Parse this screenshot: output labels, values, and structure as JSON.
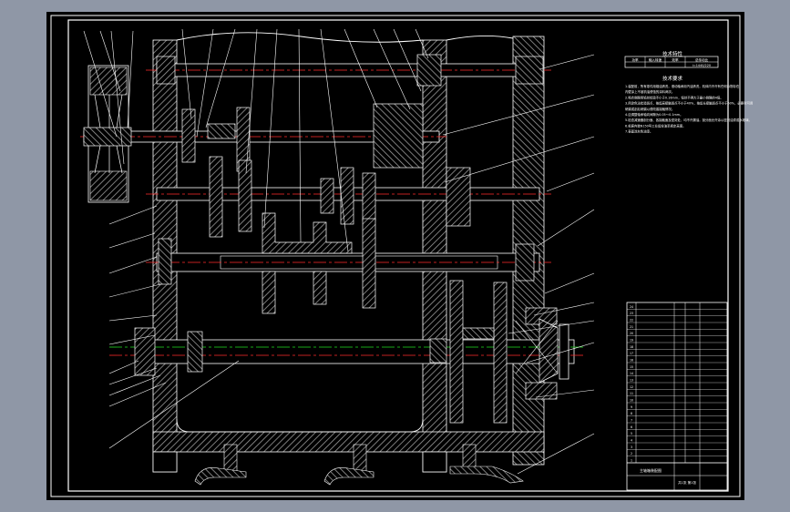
{
  "colors": {
    "background": "#8f97a6",
    "sheet": "#000000",
    "line": "#ffffff",
    "centerline": "#ff2a2a",
    "axis_alt": "#22dd22",
    "section": "#bbbbbb"
  },
  "tech_table": {
    "title": "技术特性",
    "headers": [
      "功率",
      "输入转速",
      "效率",
      "总传动比"
    ],
    "values": [
      "",
      "",
      "",
      "i=1440/220"
    ]
  },
  "tech_req": {
    "title": "技术要求",
    "lines": [
      "1.装配前，所有零件用煤油清洗，滚动轴承用汽油清洗，机体内不许有任何杂物存在，",
      "  内壁涂上不被机油侵蚀的涂料两次。",
      "2.啮合侧隙用铅丝检验不小于0.16mm，铅丝不得大于最小侧隙的4倍。",
      "3.用涂色法检验斑点，按齿高接触斑点不小于40%，按齿长接触斑点不小于50%，必要时可用",
      "  研磨或刮后研磨以便改善接触情况。",
      "4.应调整轴承轴向间隙为0.05～0.1mm。",
      "5.检查减速器剖分面、各接触面及密封处，均不许漏油。剖分面允许涂以密封油漆或水玻璃，",
      "6.机座内装N150号工业齿轮油至规定高度。",
      "7.表面涂灰色油漆。"
    ]
  },
  "bom_rows": [
    {
      "no": "24",
      "name": "",
      "qty": "",
      "mat": "",
      "note": ""
    },
    {
      "no": "23",
      "name": "",
      "qty": "",
      "mat": "",
      "note": ""
    },
    {
      "no": "22",
      "name": "",
      "qty": "",
      "mat": "",
      "note": ""
    },
    {
      "no": "21",
      "name": "",
      "qty": "",
      "mat": "",
      "note": ""
    },
    {
      "no": "20",
      "name": "",
      "qty": "",
      "mat": "",
      "note": ""
    },
    {
      "no": "19",
      "name": "",
      "qty": "",
      "mat": "",
      "note": ""
    },
    {
      "no": "18",
      "name": "",
      "qty": "",
      "mat": "",
      "note": ""
    },
    {
      "no": "17",
      "name": "",
      "qty": "",
      "mat": "",
      "note": ""
    },
    {
      "no": "16",
      "name": "",
      "qty": "",
      "mat": "",
      "note": ""
    },
    {
      "no": "15",
      "name": "",
      "qty": "",
      "mat": "",
      "note": ""
    },
    {
      "no": "14",
      "name": "",
      "qty": "",
      "mat": "",
      "note": ""
    },
    {
      "no": "13",
      "name": "",
      "qty": "",
      "mat": "",
      "note": ""
    },
    {
      "no": "12",
      "name": "",
      "qty": "",
      "mat": "",
      "note": ""
    },
    {
      "no": "11",
      "name": "",
      "qty": "",
      "mat": "",
      "note": ""
    },
    {
      "no": "10",
      "name": "",
      "qty": "",
      "mat": "",
      "note": ""
    },
    {
      "no": "9",
      "name": "",
      "qty": "",
      "mat": "",
      "note": ""
    },
    {
      "no": "8",
      "name": "",
      "qty": "",
      "mat": "",
      "note": ""
    },
    {
      "no": "7",
      "name": "",
      "qty": "",
      "mat": "",
      "note": ""
    },
    {
      "no": "6",
      "name": "",
      "qty": "",
      "mat": "",
      "note": ""
    },
    {
      "no": "5",
      "name": "",
      "qty": "",
      "mat": "",
      "note": ""
    },
    {
      "no": "4",
      "name": "",
      "qty": "",
      "mat": "",
      "note": ""
    },
    {
      "no": "3",
      "name": "",
      "qty": "",
      "mat": "",
      "note": ""
    },
    {
      "no": "2",
      "name": "",
      "qty": "",
      "mat": "",
      "note": ""
    },
    {
      "no": "1",
      "name": "",
      "qty": "",
      "mat": "",
      "note": ""
    }
  ],
  "title_block": {
    "drawing_name": "主轴箱装配图",
    "sheet_info": "共1张 第1张"
  }
}
